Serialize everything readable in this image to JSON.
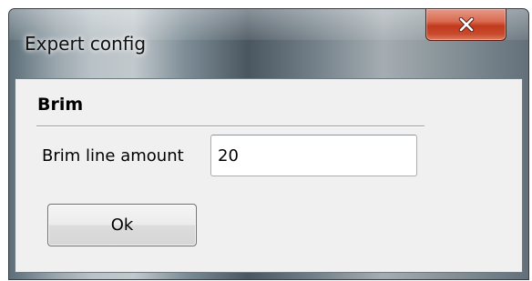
{
  "window": {
    "title": "Expert config",
    "close_icon": "close-icon"
  },
  "group": {
    "title": "Brim",
    "field": {
      "label": "Brim line amount",
      "value": "20"
    }
  },
  "actions": {
    "ok_label": "Ok"
  },
  "colors": {
    "close_button": "#c7492b",
    "client_background": "#f0f0f0"
  }
}
